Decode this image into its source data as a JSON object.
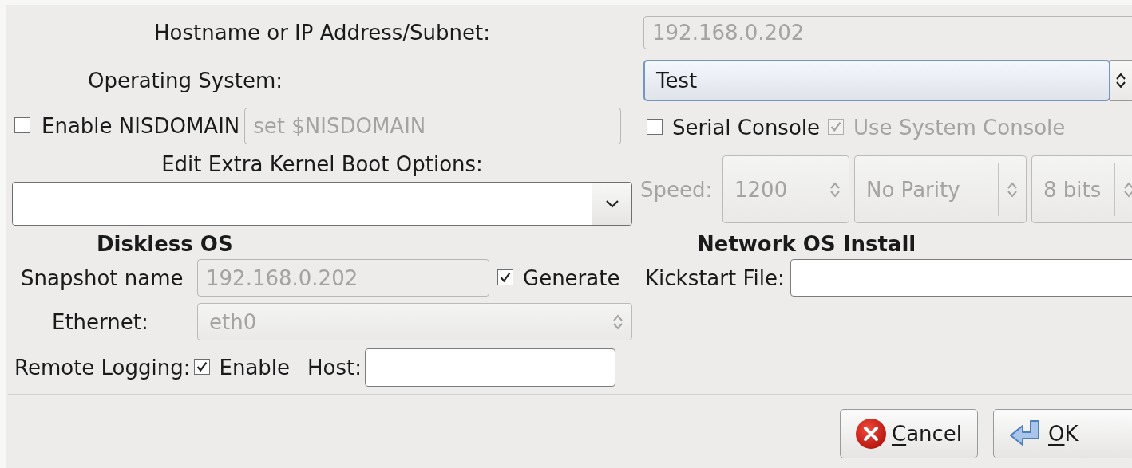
{
  "host": {
    "label": "Hostname or IP Address/Subnet:",
    "value": "192.168.0.202",
    "disabled": true
  },
  "os": {
    "label": "Operating System:",
    "value": "Test",
    "focused": true
  },
  "nisdomain": {
    "label": "Enable NISDOMAIN",
    "checked": false,
    "value": "set $NISDOMAIN",
    "disabled": true
  },
  "kernel_options": {
    "label": "Edit Extra Kernel Boot Options:"
  },
  "serial_console": {
    "label": "Serial Console",
    "checked": false
  },
  "use_system_console": {
    "label": "Use System Console",
    "checked": true,
    "disabled": true
  },
  "serial_settings": {
    "label": "Speed:",
    "disabled": true,
    "selects": [
      {
        "value": "1200"
      },
      {
        "value": "No Parity"
      },
      {
        "value": "8 bits"
      }
    ]
  },
  "diskless": {
    "heading": "Diskless OS",
    "snapshot": {
      "label": "Snapshot name",
      "value": "192.168.0.202",
      "disabled": true
    },
    "generate": {
      "label": "Generate",
      "checked": true
    },
    "ethernet": {
      "label": "Ethernet:",
      "value": "eth0",
      "disabled": true
    },
    "remote_logging": {
      "label": "Remote Logging:",
      "checkbox_label": "Enable",
      "checked": true,
      "host_label": "Host:"
    }
  },
  "network_install": {
    "heading": "Network OS Install",
    "kickstart": {
      "label": "Kickstart File:"
    }
  },
  "buttons": [
    {
      "label": "Cancel",
      "kind": "cancel",
      "mnemonic_underlined": true
    },
    {
      "label": "OK",
      "kind": "ok",
      "mnemonic_underlined": true
    }
  ]
}
